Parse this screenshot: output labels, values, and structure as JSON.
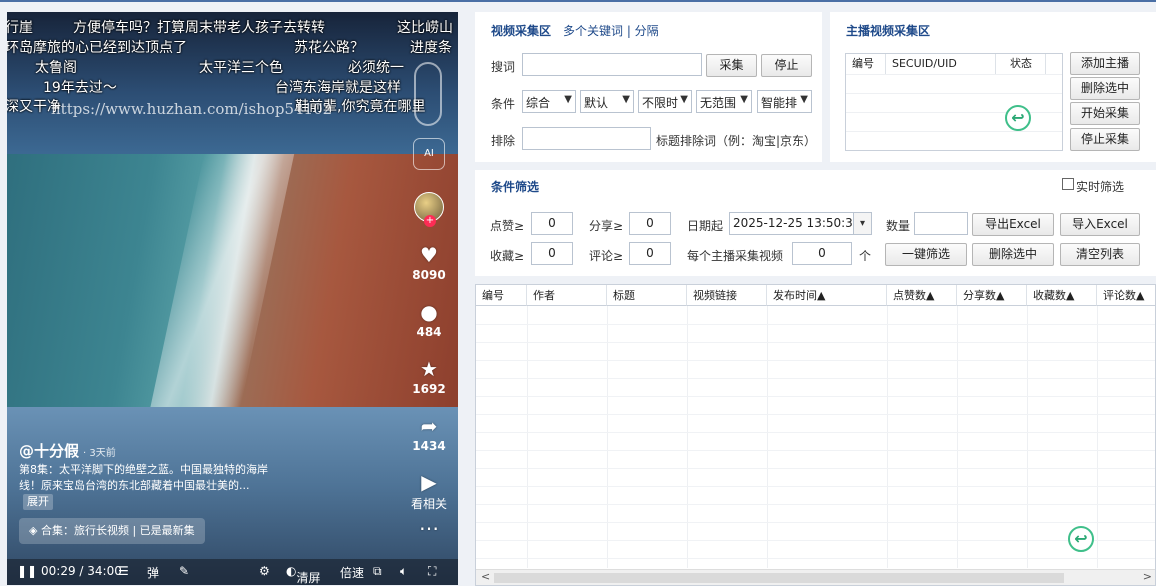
{
  "video": {
    "danmaku": [
      "行崖",
      "方便停车吗？打算周末带老人孩子去转转",
      "这比崂山",
      "环岛摩旅的心已经到达顶点了",
      "苏花公路？",
      "进度条",
      "太鲁阁",
      "太平洋三个色",
      "必须统一",
      "19年去过～",
      "台湾东海岸就是这样",
      "深又干净",
      "鞋前辈,你究竟在哪里"
    ],
    "watermark": "https://www.huzhan.com/ishop54102",
    "ai_label": "AI",
    "likes": "8090",
    "comments": "484",
    "favorites": "1692",
    "shares": "1434",
    "watch_related": "看相关",
    "author": "@十分假",
    "posted": "· 3天前",
    "description": "第8集：太平洋脚下的绝壁之蓝。中国最独特的海岸线！原来宝岛台湾的东北部藏着中国最壮美的...",
    "expand": "展开",
    "collection": "合集：旅行长视频 | 已是最新集",
    "time": "00:29 / 34:00",
    "ctrl_danmu": "弹",
    "ctrl_clear": "清屏",
    "ctrl_speed": "倍速"
  },
  "collect": {
    "title": "视频采集区",
    "multi_kw": "多个关键词 | 分隔",
    "search_label": "搜词",
    "search_value": "",
    "collect_btn": "采集",
    "stop_btn": "停止",
    "cond_label": "条件",
    "selects": [
      "综合",
      "默认",
      "不限时",
      "无范围",
      "智能排"
    ],
    "exclude_label": "排除",
    "exclude_value": "",
    "exclude_hint": "标题排除词（例：淘宝|京东）"
  },
  "anchor": {
    "title": "主播视频采集区",
    "columns": [
      "编号",
      "SECUID/UID",
      "状态"
    ],
    "add_btn": "添加主播",
    "del_btn": "删除选中",
    "start_btn": "开始采集",
    "stop_btn": "停止采集"
  },
  "filter": {
    "title": "条件筛选",
    "realtime": "实时筛选",
    "likes_label": "点赞≥",
    "likes": "0",
    "shares_label": "分享≥",
    "shares": "0",
    "date_label": "日期起",
    "date": "2025-12-25 13:50:35",
    "count_label": "数量",
    "count": "",
    "export_btn": "导出Excel",
    "import_btn": "导入Excel",
    "fav_label": "收藏≥",
    "fav": "0",
    "comment_label": "评论≥",
    "comment": "0",
    "per_anchor_label": "每个主播采集视频",
    "per_anchor": "0",
    "unit": "个",
    "oneclick_btn": "一键筛选",
    "delete_btn": "删除选中",
    "clear_btn": "清空列表"
  },
  "grid": {
    "columns": [
      "编号",
      "作者",
      "标题",
      "视频链接",
      "发布时间▲",
      "点赞数▲",
      "分享数▲",
      "收藏数▲",
      "评论数▲"
    ]
  },
  "colors": {
    "accent": "#1f4a8a",
    "icon_green": "#2aa874"
  }
}
